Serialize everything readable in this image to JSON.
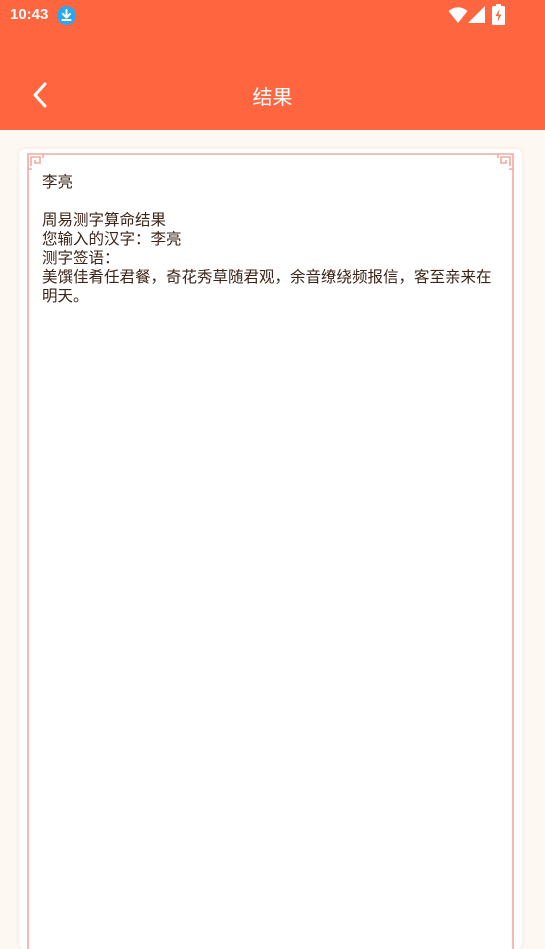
{
  "status_bar": {
    "time": "10:43",
    "icons": [
      "download-notification-icon",
      "wifi-icon",
      "signal-icon",
      "battery-charging-icon"
    ]
  },
  "header": {
    "title": "结果",
    "back_icon": "chevron-left-icon"
  },
  "result": {
    "name": "李亮",
    "heading": "周易测字算命结果",
    "input_line": "您输入的汉字：李亮",
    "sign_label": "测字签语：",
    "sign_text": "美馔佳肴任君餐，奇花秀草随君观，余音缭绕频报信，客至亲来在明天。"
  },
  "colors": {
    "header_bg": "#ff6640",
    "page_bg": "#fdf8f2",
    "frame_line": "#f4a8a0",
    "text": "#3c2418",
    "download_badge": "#2aa8ee"
  }
}
